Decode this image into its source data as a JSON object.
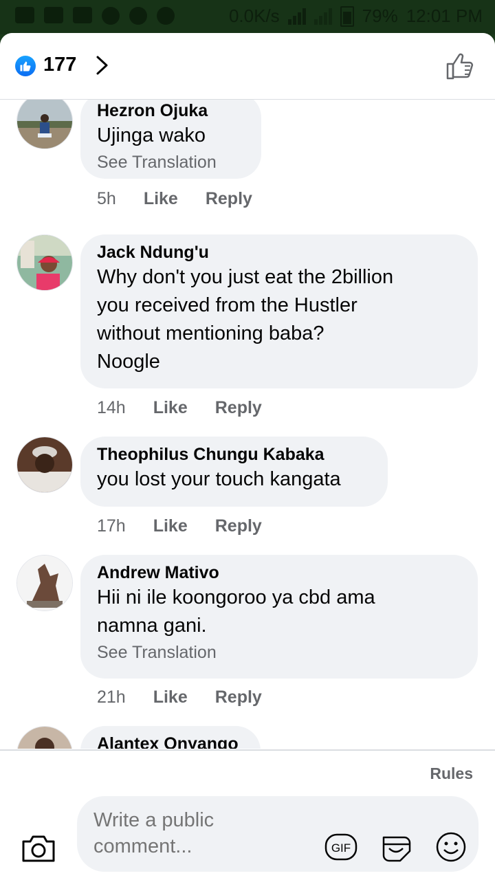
{
  "status_bar": {
    "speed": "0.0K/s",
    "battery": "79%",
    "time": "12:01 PM"
  },
  "header": {
    "like_count": "177",
    "like_icon": "like-badge-icon",
    "chevron_icon": "chevron-right-icon",
    "thumb_icon": "thumbs-up-outline-icon"
  },
  "comments": [
    {
      "author": "Hezron Ojuka",
      "lines": [
        "Ujinga wako"
      ],
      "see_translation": "See Translation",
      "time": "5h",
      "like": "Like",
      "reply": "Reply"
    },
    {
      "author": "Jack Ndung'u",
      "lines": [
        "Why don't you just eat the 2billion",
        "you received from the Hustler",
        "without mentioning baba?",
        "Noogle"
      ],
      "see_translation": "",
      "time": "14h",
      "like": "Like",
      "reply": "Reply"
    },
    {
      "author": "Theophilus Chungu Kabaka",
      "lines": [
        "you lost your touch kangata"
      ],
      "see_translation": "",
      "time": "17h",
      "like": "Like",
      "reply": "Reply"
    },
    {
      "author": "Andrew Mativo",
      "lines": [
        "Hii ni ile koongoroo ya cbd ama",
        "namna gani."
      ],
      "see_translation": "See Translation",
      "time": "21h",
      "like": "Like",
      "reply": "Reply"
    },
    {
      "author": "Alantex Onyango",
      "lines": [],
      "see_translation": "",
      "time": "",
      "like": "",
      "reply": ""
    }
  ],
  "footer": {
    "rules": "Rules",
    "placeholder": "Write a public comment...",
    "gif_label": "GIF",
    "icons": [
      "camera-icon",
      "gif-icon",
      "sticker-icon",
      "emoji-icon"
    ]
  },
  "colors": {
    "bubble": "#f0f2f5",
    "meta_text": "#65676b",
    "like_blue": "#0c6df2"
  }
}
